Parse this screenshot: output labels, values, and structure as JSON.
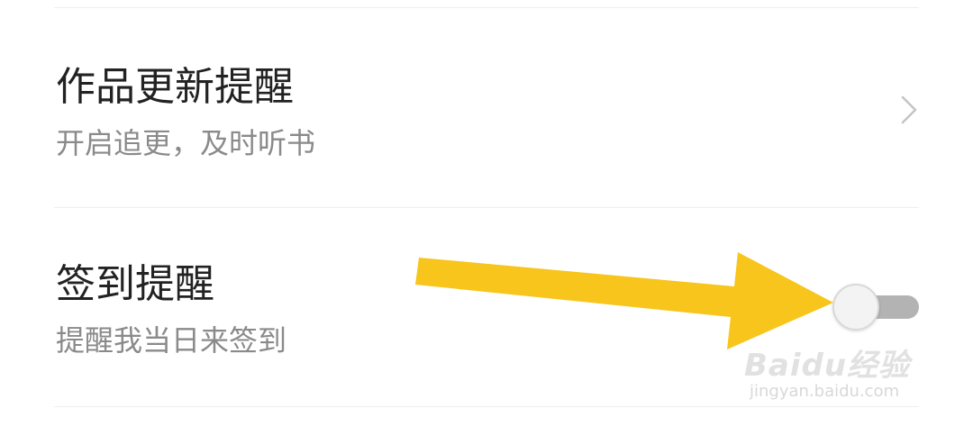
{
  "settings": {
    "items": [
      {
        "title": "作品更新提醒",
        "subtitle": "开启追更，及时听书",
        "control": "chevron-right-icon"
      },
      {
        "title": "签到提醒",
        "subtitle": "提醒我当日来签到",
        "control": "toggle",
        "toggle_on": false
      }
    ]
  },
  "annotation": {
    "arrow_color": "#f7c51c",
    "arrow_target": "sign-in-reminder-toggle"
  },
  "watermark": {
    "brand": "Baidu经验",
    "url": "jingyan.baidu.com"
  },
  "colors": {
    "title_text": "#222222",
    "subtitle_text": "#8a8a8a",
    "toggle_track_off": "#b3b3b3",
    "toggle_knob": "#f3f3f3"
  }
}
